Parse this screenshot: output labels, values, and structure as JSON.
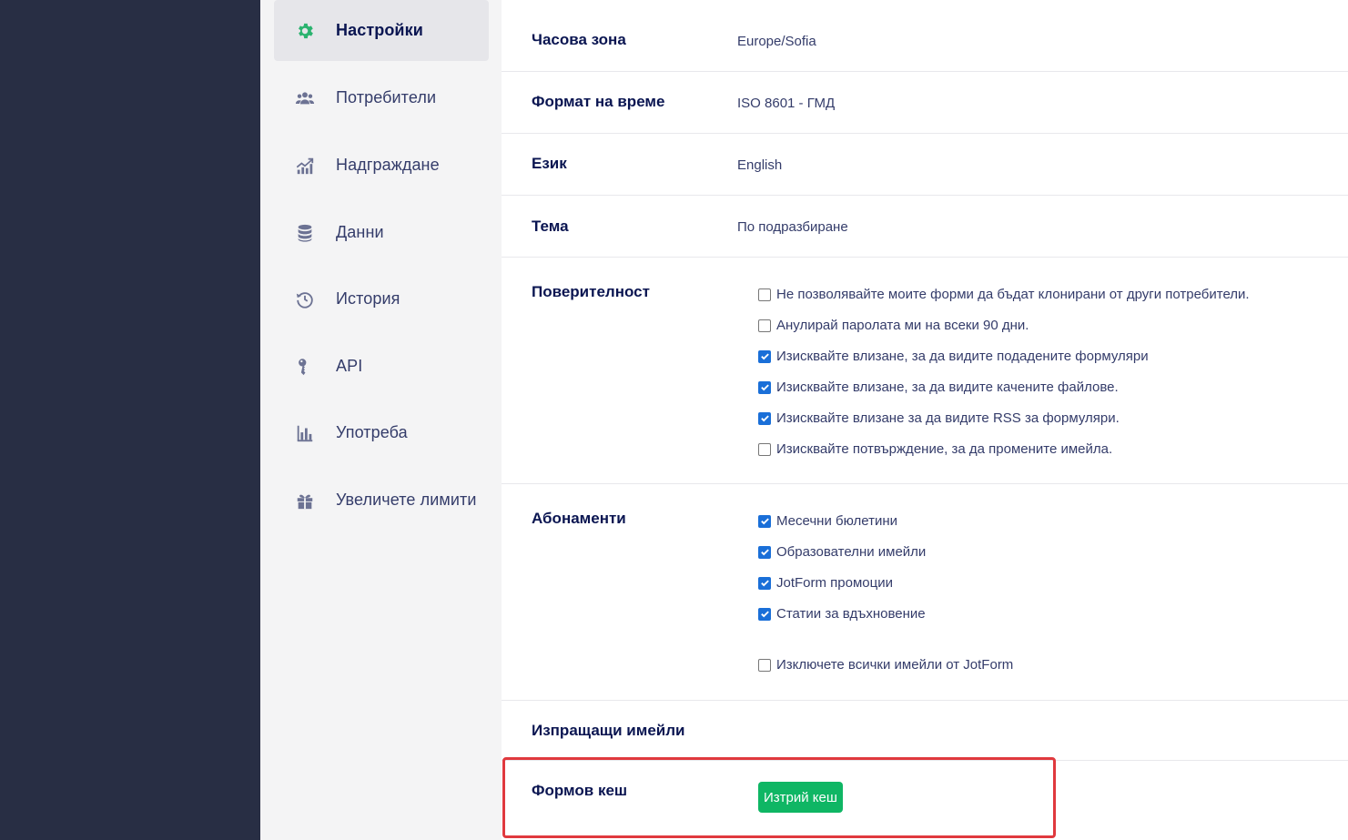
{
  "colors": {
    "rail": "#282e44",
    "sidebar": "#f4f4f5",
    "accent_green": "#0fb664",
    "checkbox_blue": "#1a6fd8",
    "highlight_red": "#e0393e"
  },
  "sidebar": {
    "items": [
      {
        "label": "Настройки",
        "icon": "gear-icon",
        "active": true
      },
      {
        "label": "Потребители",
        "icon": "users-icon",
        "active": false
      },
      {
        "label": "Надграждане",
        "icon": "upgrade-chart-icon",
        "active": false
      },
      {
        "label": "Данни",
        "icon": "database-icon",
        "active": false
      },
      {
        "label": "История",
        "icon": "history-icon",
        "active": false
      },
      {
        "label": "API",
        "icon": "api-key-icon",
        "active": false
      },
      {
        "label": "Употреба",
        "icon": "bar-chart-icon",
        "active": false
      },
      {
        "label": "Увеличете лимити",
        "icon": "gift-icon",
        "active": false
      }
    ]
  },
  "settings": {
    "timezone": {
      "label": "Часова зона",
      "value": "Europe/Sofia"
    },
    "time_format": {
      "label": "Формат на време",
      "value": "ISO 8601 - ГМД"
    },
    "language": {
      "label": "Език",
      "value": "English"
    },
    "theme": {
      "label": "Тема",
      "value": "По подразбиране"
    },
    "privacy": {
      "label": "Поверителност",
      "options": [
        {
          "text": "Не позволявайте моите форми да бъдат клонирани от други потребители.",
          "checked": false
        },
        {
          "text": "Анулирай паролата ми на всеки 90 дни.",
          "checked": false
        },
        {
          "text": "Изисквайте влизане, за да видите подадените формуляри",
          "checked": true
        },
        {
          "text": "Изисквайте влизане, за да видите качените файлове.",
          "checked": true
        },
        {
          "text": "Изисквайте влизане за да видите RSS за формуляри.",
          "checked": true
        },
        {
          "text": "Изисквайте потвърждение, за да промените имейла.",
          "checked": false
        }
      ]
    },
    "subscriptions": {
      "label": "Абонаменти",
      "options": [
        {
          "text": "Месечни бюлетини",
          "checked": true
        },
        {
          "text": "Образователни имейли",
          "checked": true
        },
        {
          "text": "JotForm промоции",
          "checked": true
        },
        {
          "text": "Статии за вдъхновение",
          "checked": true
        },
        {
          "text": "Изключете всички имейли от JotForm",
          "checked": false
        }
      ]
    },
    "sending_emails": {
      "label": "Изпращащи имейли"
    },
    "form_cache": {
      "label": "Формов кеш",
      "button_label": "Изтрий кеш"
    }
  }
}
